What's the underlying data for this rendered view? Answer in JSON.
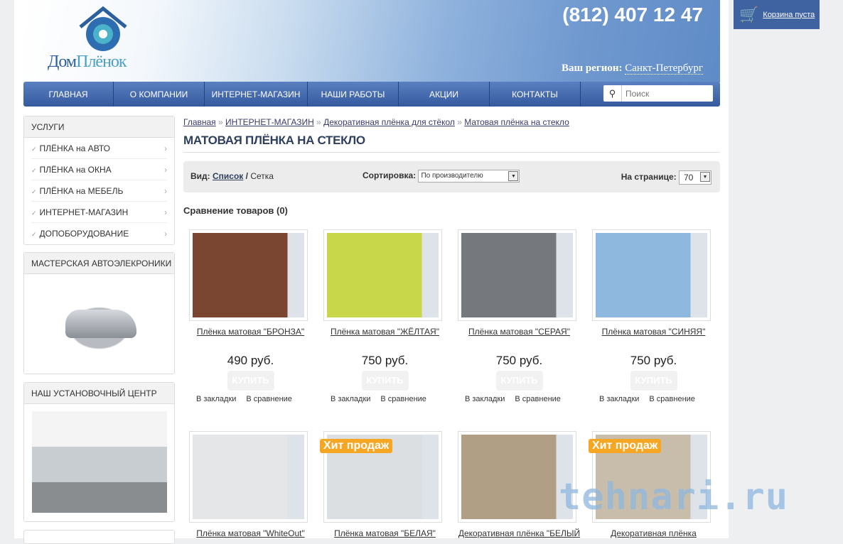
{
  "header": {
    "logo_text_1": "Дом",
    "logo_text_2": "Плёнок",
    "phone": "(812) 407 12 47",
    "region_label": "Ваш регион:",
    "region_value": "Санкт-Петербург"
  },
  "cart": {
    "label": "Корзина пуста"
  },
  "nav": {
    "items": [
      "ГЛАВНАЯ",
      "О КОМПАНИИ",
      "ИНТЕРНЕТ-МАГАЗИН",
      "НАШИ РАБОТЫ",
      "АКЦИИ",
      "КОНТАКТЫ"
    ],
    "search_placeholder": "Поиск"
  },
  "sidebar": {
    "services_title": "УСЛУГИ",
    "services": [
      "ПЛЁНКА на АВТО",
      "ПЛЁНКА на ОКНА",
      "ПЛЁНКА на МЕБЕЛЬ",
      "ИНТЕРНЕТ-МАГАЗИН",
      "ДОПОБОРУДОВАНИЕ"
    ],
    "workshop_title": "МАСТЕРСКАЯ АВТОЭЛЕКРОНИКИ",
    "center_title": "НАШ УСТАНОВОЧНЫЙ ЦЕНТР"
  },
  "breadcrumb": [
    "Главная",
    "ИНТЕРНЕТ-МАГАЗИН",
    "Декоративная плёнка для стёкол",
    "Матовая плёнка на стекло"
  ],
  "page_title": "МАТОВАЯ ПЛЁНКА НА СТЕКЛО",
  "tools": {
    "view_label": "Вид:",
    "view_list": "Список",
    "view_sep": "/",
    "view_grid": "Сетка",
    "sort_label": "Сортировка:",
    "sort_value": "По производителю",
    "per_page_label": "На странице:",
    "per_page_value": "70"
  },
  "compare": "Сравнение товаров (0)",
  "product_actions": {
    "buy": "КУПИТЬ",
    "bookmark": "В закладки",
    "compare": "В сравнение",
    "hit": "Хит продаж"
  },
  "products": [
    {
      "title": "Плёнка матовая \"БРОНЗА\"",
      "price": "490 руб.",
      "color": "#7a4632"
    },
    {
      "title": "Плёнка матовая \"ЖЁЛТАЯ\"",
      "price": "750 руб.",
      "color": "#c8d64a"
    },
    {
      "title": "Плёнка матовая \"СЕРАЯ\"",
      "price": "750 руб.",
      "color": "#75787d"
    },
    {
      "title": "Плёнка матовая \"СИНЯЯ\"",
      "price": "750 руб.",
      "color": "#8fb8de"
    },
    {
      "title": "Плёнка матовая \"WhiteOut\"",
      "color": "#e4e6e8"
    },
    {
      "title": "Плёнка матовая \"БЕЛАЯ\"",
      "color": "#dcdfe2"
    },
    {
      "title": "Декоративная плёнка \"БЕЛЫЙ",
      "color": "#b09f85"
    },
    {
      "title": "Декоративная плёнка",
      "color": "#c8bcab"
    }
  ],
  "watermark": "tehnari.ru"
}
